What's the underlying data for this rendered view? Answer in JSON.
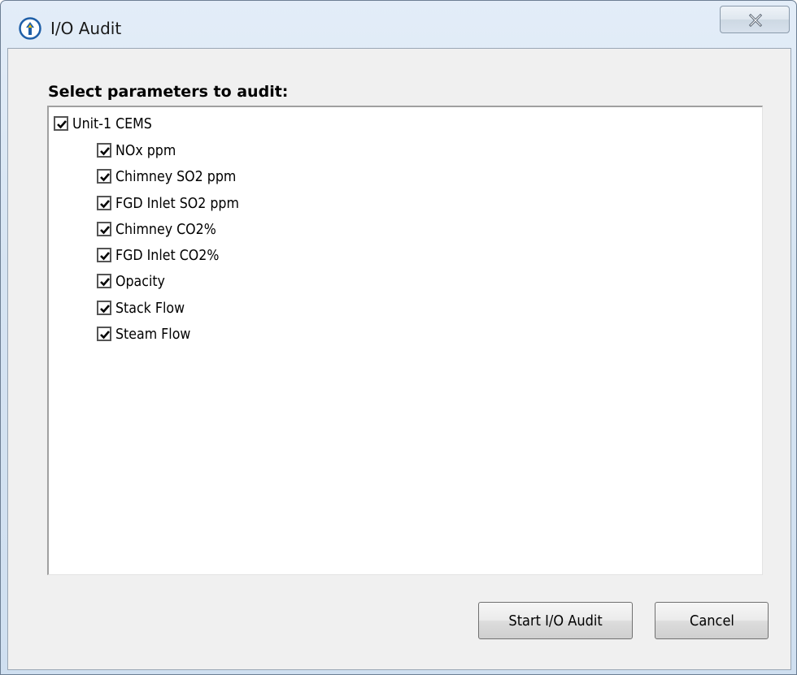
{
  "window": {
    "title": "I/O Audit",
    "app_icon": "tree-logo-icon",
    "close_icon": "close-icon"
  },
  "dialog": {
    "prompt": "Select parameters to audit:",
    "tree": {
      "root": {
        "label": "Unit-1 CEMS",
        "checked": true
      },
      "children": [
        {
          "label": "NOx ppm",
          "checked": true
        },
        {
          "label": "Chimney SO2 ppm",
          "checked": true
        },
        {
          "label": "FGD Inlet SO2 ppm",
          "checked": true
        },
        {
          "label": "Chimney CO2%",
          "checked": true
        },
        {
          "label": "FGD Inlet CO2%",
          "checked": true
        },
        {
          "label": "Opacity",
          "checked": true
        },
        {
          "label": "Stack Flow",
          "checked": true
        },
        {
          "label": "Steam Flow",
          "checked": true
        }
      ]
    },
    "buttons": {
      "start_label": "Start I/O Audit",
      "cancel_label": "Cancel"
    }
  },
  "colors": {
    "accent": "#1f5fa8",
    "frame": "#d6e4f2",
    "client": "#f0f0f0"
  }
}
